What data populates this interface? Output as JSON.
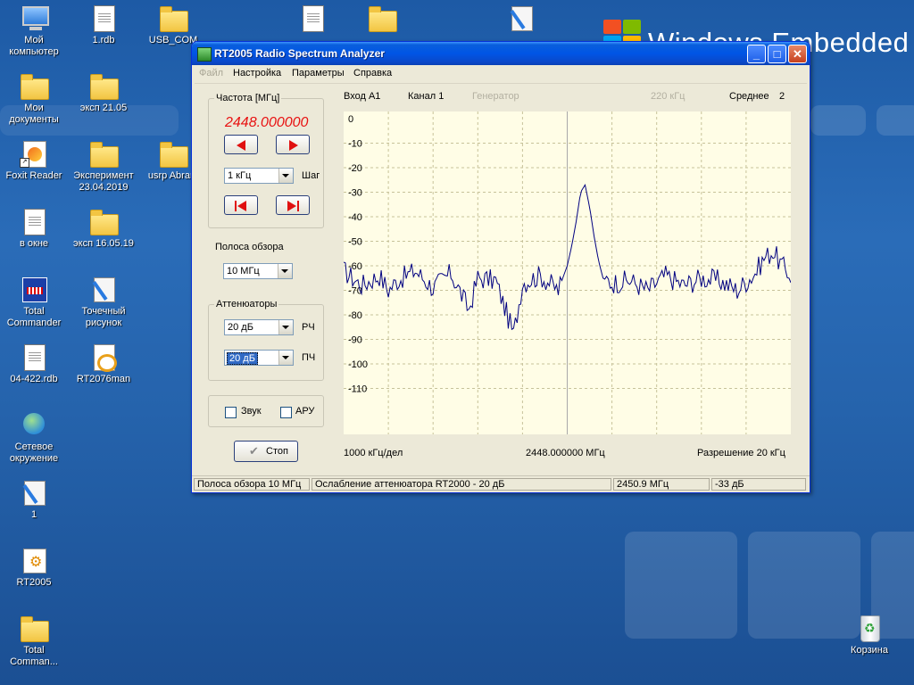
{
  "desktop": {
    "brand_text": "Windows Embedded",
    "icons": [
      {
        "label": "Мой компьютер"
      },
      {
        "label": "1.rdb"
      },
      {
        "label": "USB_COM"
      },
      {
        "label": "Мои документы"
      },
      {
        "label": "эксп 21.05"
      },
      {
        "label": "Foxit Reader"
      },
      {
        "label": "Эксперимент 23.04.2019"
      },
      {
        "label": "usrp Abram"
      },
      {
        "label": "в окне"
      },
      {
        "label": "эксп 16.05.19"
      },
      {
        "label": "Total Commander"
      },
      {
        "label": "Точечный рисунок"
      },
      {
        "label": "04-422.rdb"
      },
      {
        "label": "RT2076man"
      },
      {
        "label": "Сетевое окружение"
      },
      {
        "label": "1"
      },
      {
        "label": "RT2005"
      },
      {
        "label": "Total Comman..."
      },
      {
        "label": "Корзина"
      }
    ]
  },
  "window": {
    "title": "RT2005 Radio Spectrum Analyzer",
    "buttons": {
      "minimize": "_",
      "maximize": "□",
      "close": "✕"
    },
    "menu": [
      "Файл",
      "Настройка",
      "Параметры",
      "Справка"
    ],
    "frequency": {
      "group_label": "Частота [МГц]",
      "value": "2448.000000",
      "step_value": "1 кГц",
      "step_label": "Шаг"
    },
    "span": {
      "label": "Полоса обзора",
      "value": "10 МГц"
    },
    "attenuators": {
      "group_label": "Аттенюаторы",
      "rf_value": "20 дБ",
      "rf_label": "РЧ",
      "if_value": "20 дБ",
      "if_label": "ПЧ"
    },
    "options": {
      "sound": "Звук",
      "agc": "АРУ"
    },
    "stop_button": "Стоп",
    "header": {
      "input": "Вход А1",
      "channel": "Канал 1",
      "generator": "Генератор",
      "bandwidth": "220 кГц",
      "average_label": "Среднее",
      "average_value": "2"
    },
    "footer": {
      "scale": "1000  кГц/дел",
      "center": "2448.000000  МГц",
      "resolution": "Разрешение 20 кГц"
    },
    "status": {
      "span": "Полоса обзора 10 МГц",
      "attenuation": "Ослабление аттенюатора RT2000 - 20 дБ",
      "marker_freq": "2450.9 МГц",
      "marker_level": "-33 дБ"
    }
  },
  "chart_data": {
    "type": "line",
    "xlabel": "",
    "ylabel": "",
    "x_range_mhz": [
      2443,
      2453
    ],
    "center_mhz": 2448,
    "ylim": [
      -120,
      0
    ],
    "y_ticks": [
      0,
      -10,
      -20,
      -30,
      -40,
      -50,
      -60,
      -70,
      -80,
      -90,
      -100,
      -110
    ],
    "grid": true,
    "background": "#fffde6",
    "line_color": "#000080",
    "noise_floor": -67,
    "series": [
      {
        "x": [
          2443.0,
          2443.4,
          2443.8,
          2444.0,
          2444.2,
          2444.6,
          2445.0,
          2445.4,
          2445.8,
          2446.0,
          2446.4,
          2446.8,
          2447.0,
          2447.4,
          2447.8,
          2448.0,
          2448.1,
          2448.2,
          2448.3,
          2448.4,
          2448.5,
          2448.6,
          2448.7,
          2448.8,
          2449.0,
          2449.4,
          2449.8,
          2450.2,
          2450.6,
          2451.0,
          2451.4,
          2451.8,
          2452.2,
          2452.4,
          2452.6,
          2452.8,
          2453.0
        ],
        "values": [
          -62,
          -68,
          -64,
          -70,
          -66,
          -62,
          -69,
          -63,
          -78,
          -65,
          -66,
          -88,
          -67,
          -64,
          -70,
          -60,
          -52,
          -42,
          -30,
          -27,
          -36,
          -48,
          -58,
          -65,
          -67,
          -66,
          -70,
          -64,
          -68,
          -65,
          -66,
          -70,
          -63,
          -57,
          -54,
          -60,
          -64
        ]
      }
    ]
  }
}
